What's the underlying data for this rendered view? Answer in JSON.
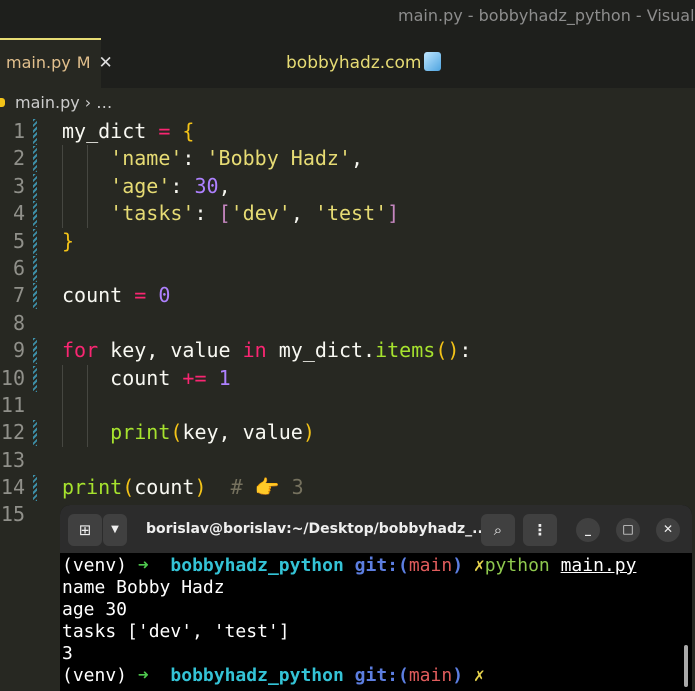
{
  "window_title": "main.py - bobbyhadz_python - Visual Studio Code",
  "tab": {
    "name": "main.py",
    "status": "M",
    "close": "✕"
  },
  "banner": "bobbyhadz.com",
  "breadcrumb": {
    "file": "main.py",
    "sep": "›",
    "more": "…"
  },
  "code": [
    [
      [
        "id",
        "my_dict "
      ],
      [
        "op",
        "="
      ],
      [
        "id",
        " "
      ],
      [
        "br",
        "{"
      ]
    ],
    [
      [
        "id",
        "    "
      ],
      [
        "str",
        "'name'"
      ],
      [
        "id",
        ": "
      ],
      [
        "str",
        "'Bobby Hadz'"
      ],
      [
        "id",
        ","
      ]
    ],
    [
      [
        "id",
        "    "
      ],
      [
        "str",
        "'age'"
      ],
      [
        "id",
        ": "
      ],
      [
        "num",
        "30"
      ],
      [
        "id",
        ","
      ]
    ],
    [
      [
        "id",
        "    "
      ],
      [
        "str",
        "'tasks'"
      ],
      [
        "id",
        ": "
      ],
      [
        "br2",
        "["
      ],
      [
        "str",
        "'dev'"
      ],
      [
        "id",
        ", "
      ],
      [
        "str",
        "'test'"
      ],
      [
        "br2",
        "]"
      ]
    ],
    [
      [
        "br",
        "}"
      ]
    ],
    [],
    [
      [
        "id",
        "count "
      ],
      [
        "op",
        "="
      ],
      [
        "id",
        " "
      ],
      [
        "num",
        "0"
      ]
    ],
    [],
    [
      [
        "kw",
        "for"
      ],
      [
        "id",
        " key, value "
      ],
      [
        "kw",
        "in"
      ],
      [
        "id",
        " my_dict."
      ],
      [
        "fn",
        "items"
      ],
      [
        "br",
        "()"
      ],
      [
        "id",
        ":"
      ]
    ],
    [
      [
        "id",
        "    count "
      ],
      [
        "op",
        "+="
      ],
      [
        "id",
        " "
      ],
      [
        "num",
        "1"
      ]
    ],
    [],
    [
      [
        "id",
        "    "
      ],
      [
        "fn",
        "print"
      ],
      [
        "br",
        "("
      ],
      [
        "id",
        "key, value"
      ],
      [
        "br",
        ")"
      ]
    ],
    [],
    [
      [
        "fn",
        "print"
      ],
      [
        "br",
        "("
      ],
      [
        "id",
        "count"
      ],
      [
        "br",
        ")"
      ],
      [
        "id",
        "  "
      ],
      [
        "cm",
        "# 👉 3"
      ]
    ],
    []
  ],
  "terminal": {
    "title": "borislav@borislav:~/Desktop/bobbyhadz_...",
    "prompt": {
      "venv": "(venv)",
      "arrow": "➜",
      "dir": "bobbyhadz_python",
      "git": "git:(",
      "branch": "main",
      "git_close": ")",
      "dirty": "✗"
    },
    "command": {
      "prog": "python",
      "arg": "main.py"
    },
    "output": [
      "name Bobby Hadz",
      "age 30",
      "tasks ['dev', 'test']",
      "3"
    ]
  }
}
